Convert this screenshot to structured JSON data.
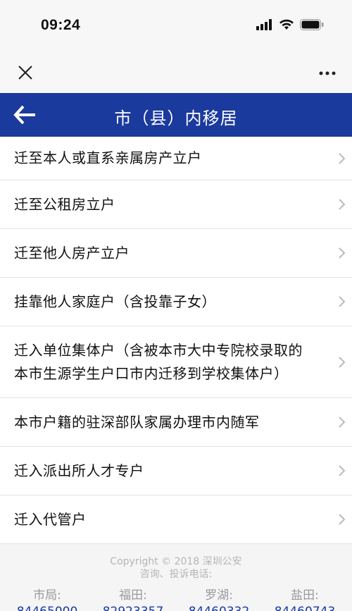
{
  "status_bar": {
    "time": "09:24"
  },
  "header": {
    "title": "市（县）内移居"
  },
  "menu_items": [
    {
      "label": "迁至本人或直系亲属房产立户"
    },
    {
      "label": "迁至公租房立户"
    },
    {
      "label": "迁至他人房产立户"
    },
    {
      "label": "挂靠他人家庭户（含投靠子女）"
    },
    {
      "label": "迁入单位集体户（含被本市大中专院校录取的本市生源学生户口市内迁移到学校集体户）"
    },
    {
      "label": "本市户籍的驻深部队家属办理市内随军"
    },
    {
      "label": "迁入派出所人才专户"
    },
    {
      "label": "迁入代管户"
    }
  ],
  "footer": {
    "copyright": "Copyright © 2018 深圳公安",
    "consult": "咨询、投诉电话:",
    "phones": [
      {
        "name": "市局:",
        "number": "84465000"
      },
      {
        "name": "福田:",
        "number": "82923357"
      },
      {
        "name": "罗湖:",
        "number": "84460332"
      },
      {
        "name": "盐田:",
        "number": "84460743"
      }
    ]
  },
  "colors": {
    "header_bg": "#1b3a9e",
    "phone_number": "#1b3a9e"
  },
  "icons": [
    "signal-icon",
    "wifi-icon",
    "battery-icon",
    "close-icon",
    "more-icon",
    "back-arrow-icon",
    "chevron-right-icon"
  ]
}
